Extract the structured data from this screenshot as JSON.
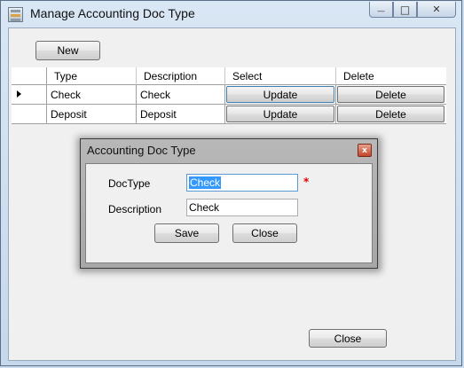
{
  "window": {
    "title": "Manage Accounting Doc Type",
    "controls": {
      "minimize": "—",
      "maximize": "□",
      "close": "✕"
    }
  },
  "toolbar": {
    "new_label": "New"
  },
  "grid": {
    "columns": [
      "Type",
      "Description",
      "Select",
      "Delete"
    ],
    "rows": [
      {
        "type": "Check",
        "description": "Check",
        "select": "Update",
        "delete": "Delete",
        "current": true
      },
      {
        "type": "Deposit",
        "description": "Deposit",
        "select": "Update",
        "delete": "Delete",
        "current": false
      }
    ]
  },
  "dialog": {
    "title": "Accounting Doc Type",
    "close_glyph": "x",
    "doctype_label": "DocType",
    "doctype_value": "Check",
    "required_marker": "*",
    "description_label": "Description",
    "description_value": "Check",
    "save_label": "Save",
    "close_label": "Close"
  },
  "footer": {
    "close_label": "Close"
  }
}
